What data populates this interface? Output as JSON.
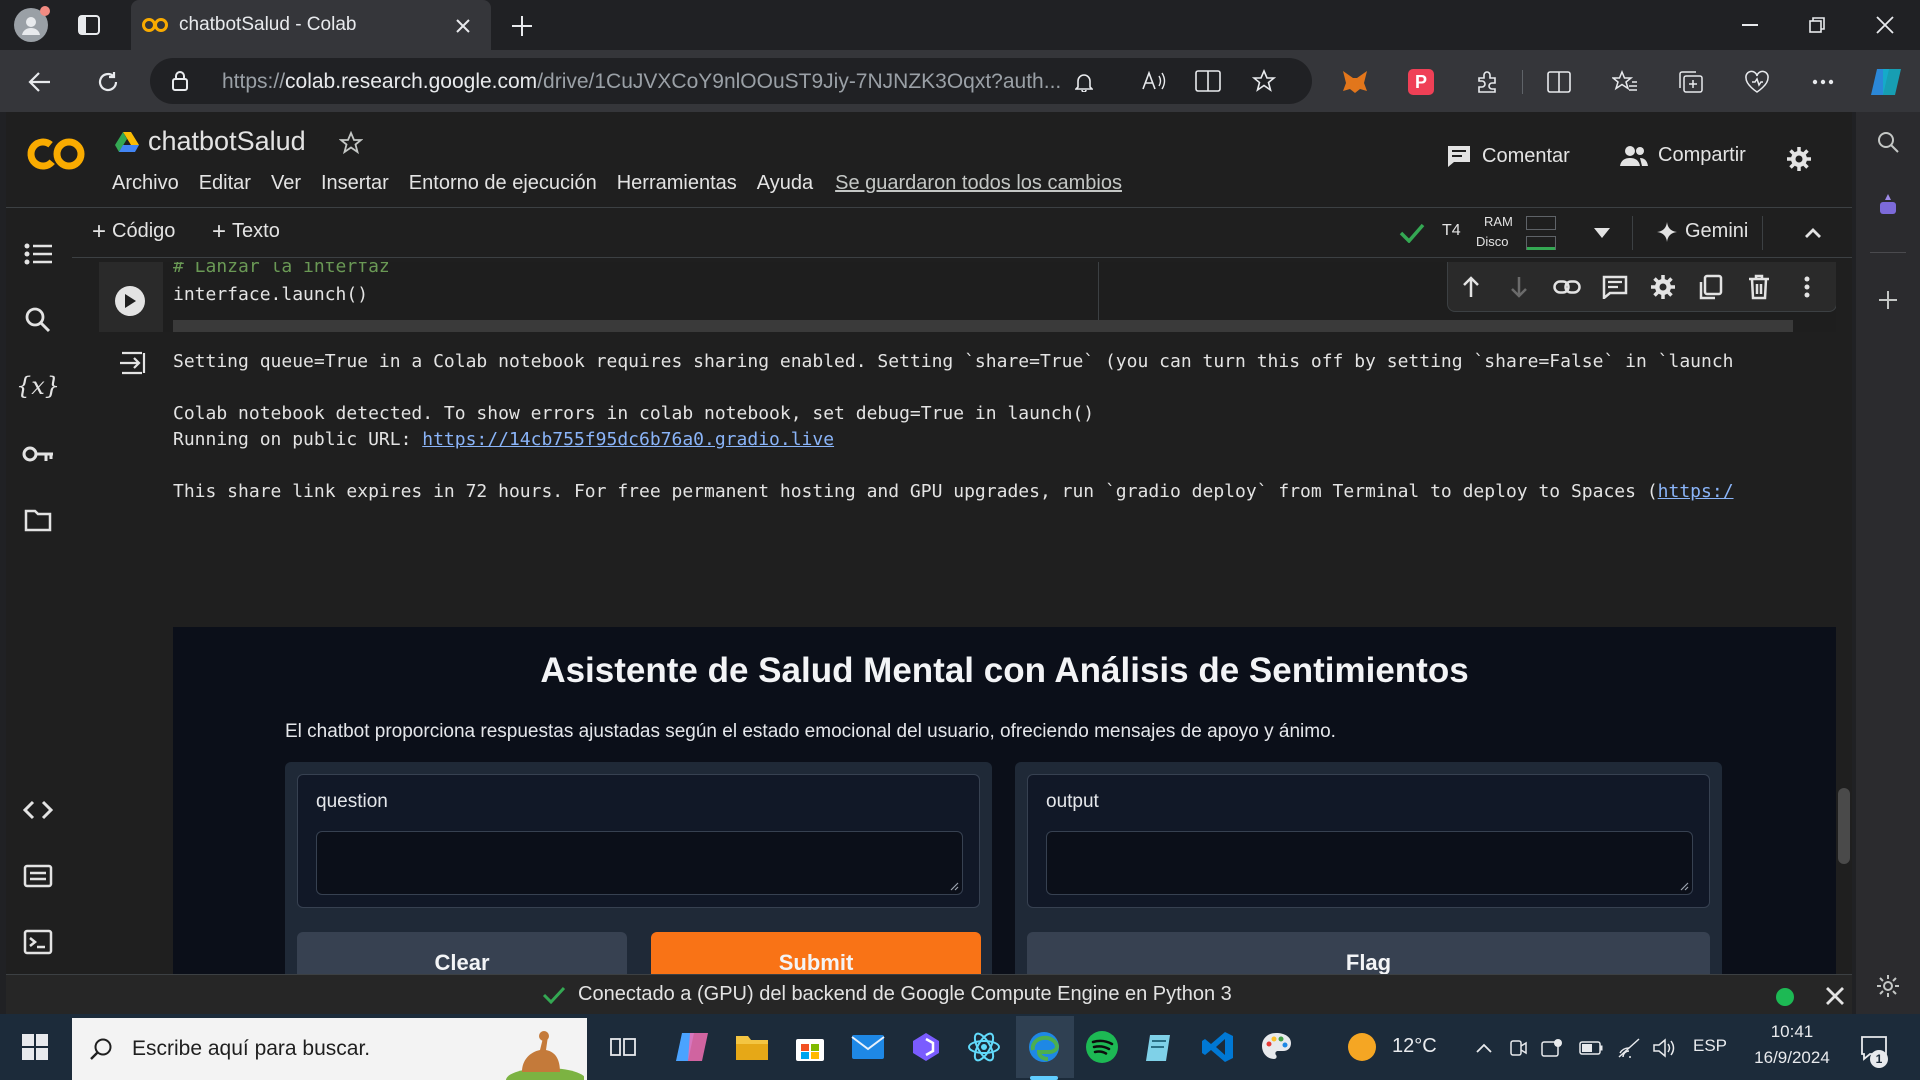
{
  "browser": {
    "tab_title": "chatbotSalud - Colab",
    "url_prefix": "https://",
    "url_domain": "colab.research.google.com",
    "url_rest": "/drive/1CuJVXCoY9nlOOuST9Jiy-7NJNZK3Oqxt?auth..."
  },
  "colab": {
    "logo": "CO",
    "notebook_title": "chatbotSalud",
    "menu": [
      "Archivo",
      "Editar",
      "Ver",
      "Insertar",
      "Entorno de ejecución",
      "Herramientas",
      "Ayuda"
    ],
    "saved_status": "Se guardaron todos los cambios",
    "comment_label": "Comentar",
    "share_label": "Compartir",
    "add_code": "Código",
    "add_text": "Texto",
    "runtime_type": "T4",
    "ram_label": "RAM",
    "disk_label": "Disco",
    "gemini_label": "Gemini",
    "code_comment": "# Lanzar la interfaz",
    "code_line": "interface.launch()",
    "output": {
      "line1": "Setting queue=True in a Colab notebook requires sharing enabled. Setting `share=True` (you can turn this off by setting `share=False` in `launch",
      "line2": "Colab notebook detected. To show errors in colab notebook, set debug=True in launch()",
      "line3_prefix": "Running on public URL: ",
      "line3_link": "https://14cb755f95dc6b76a0.gradio.live",
      "line4_prefix": "This share link expires in 72 hours. For free permanent hosting and GPU upgrades, run `gradio deploy` from Terminal to deploy to Spaces (",
      "line4_link": "https:/"
    },
    "status_text": "Conectado a (GPU) del backend de Google Compute Engine en Python 3"
  },
  "gradio": {
    "title": "Asistente de Salud Mental con Análisis de Sentimientos",
    "description": "El chatbot proporciona respuestas ajustadas según el estado emocional del usuario, ofreciendo mensajes de apoyo y ánimo.",
    "input_label": "question",
    "output_label": "output",
    "clear_label": "Clear",
    "submit_label": "Submit",
    "flag_label": "Flag",
    "colors": {
      "submit": "#f97316",
      "panel": "#1f2937",
      "background": "#0b0f19"
    }
  },
  "taskbar": {
    "search_placeholder": "Escribe aquí para buscar.",
    "temperature": "12°C",
    "language": "ESP",
    "time": "10:41",
    "date": "16/9/2024",
    "notification_count": "1"
  },
  "colors": {
    "colab_orange": "#f9ab00",
    "connected_green": "#34a853",
    "link_blue": "#8ab4f8"
  }
}
